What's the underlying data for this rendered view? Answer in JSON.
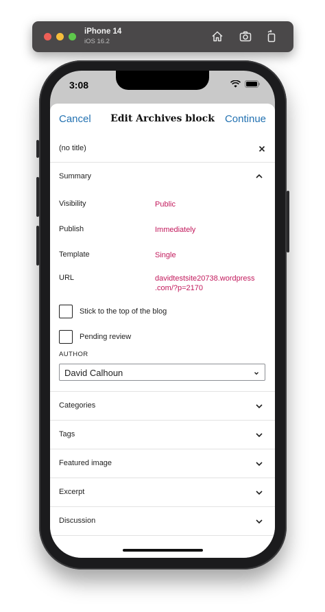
{
  "simulator": {
    "device": "iPhone 14",
    "os": "iOS 16.2",
    "buttons": [
      "home-icon",
      "screenshot-icon",
      "rotate-icon"
    ]
  },
  "status_bar": {
    "time": "3:08"
  },
  "nav": {
    "cancel_label": "Cancel",
    "title": "Edit Archives block",
    "continue_label": "Continue"
  },
  "title_field": {
    "value": "(no title)"
  },
  "summary": {
    "heading": "Summary",
    "visibility": {
      "label": "Visibility",
      "value": "Public"
    },
    "publish": {
      "label": "Publish",
      "value": "Immediately"
    },
    "template": {
      "label": "Template",
      "value": "Single"
    },
    "url": {
      "label": "URL",
      "value_line1": "davidtestsite20738.wordpress",
      "value_line2": ".com/?p=2170"
    },
    "sticky_label": "Stick to the top of the blog",
    "pending_label": "Pending review",
    "author_heading": "AUTHOR",
    "author_value": "David Calhoun"
  },
  "panels": [
    {
      "label": "Categories"
    },
    {
      "label": "Tags"
    },
    {
      "label": "Featured image"
    },
    {
      "label": "Excerpt"
    },
    {
      "label": "Discussion"
    }
  ],
  "colors": {
    "link_blue": "#2271b1",
    "value_pink": "#c2185b"
  }
}
